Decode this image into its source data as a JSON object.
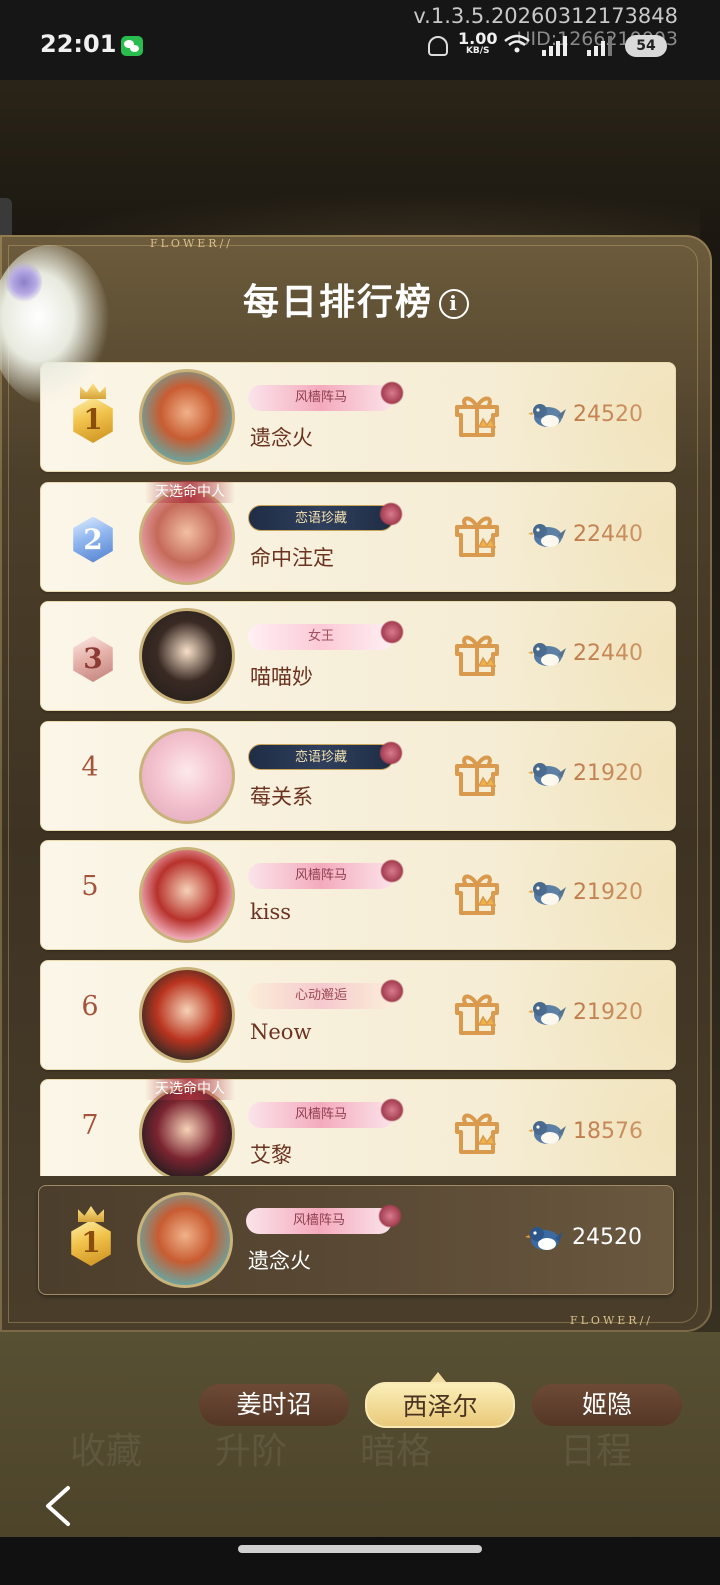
{
  "status_bar": {
    "time": "22:01",
    "version": "v.1.3.5.20260312173848",
    "uid": "UID:1266210003",
    "net_speed": "1.00",
    "net_unit": "KB/S",
    "battery": "54",
    "icons": [
      "wechat-icon",
      "bell-icon",
      "wifi-icon",
      "signal-icon",
      "battery-icon"
    ]
  },
  "panel": {
    "title": "每日排行榜",
    "info_icon": "i",
    "flower_tag": "FLOWER//"
  },
  "ranking": [
    {
      "rank": "1",
      "badge": "gold",
      "name": "遗念火",
      "title_badge": "风樯阵马",
      "title_style": "pink",
      "score": "24520"
    },
    {
      "rank": "2",
      "badge": "blue",
      "name": "命中注定",
      "title_badge": "恋语珍藏",
      "title_style": "dark",
      "avatar_banner": "天选命中人",
      "score": "22440"
    },
    {
      "rank": "3",
      "badge": "rose",
      "name": "喵喵妙",
      "title_badge": "女王",
      "title_style": "light",
      "score": "22440"
    },
    {
      "rank": "4",
      "badge": "",
      "name": "莓关系",
      "title_badge": "恋语珍藏",
      "title_style": "dark",
      "score": "21920"
    },
    {
      "rank": "5",
      "badge": "",
      "name": "kiss",
      "title_badge": "风樯阵马",
      "title_style": "pink",
      "score": "21920"
    },
    {
      "rank": "6",
      "badge": "",
      "name": "Neow",
      "title_badge": "心动邂逅",
      "title_style": "gold",
      "score": "21920"
    },
    {
      "rank": "7",
      "badge": "",
      "name": "艾黎",
      "title_badge": "风樯阵马",
      "title_style": "pink",
      "avatar_banner": "天选命中人",
      "score": "18576"
    }
  ],
  "self_entry": {
    "rank": "1",
    "name": "遗念火",
    "title_badge": "风樯阵马",
    "score": "24520"
  },
  "tabs": [
    {
      "label": "姜时诏",
      "active": false
    },
    {
      "label": "西泽尔",
      "active": true
    },
    {
      "label": "姬隐",
      "active": false
    }
  ],
  "background_text": [
    "收藏",
    "升阶",
    "暗格",
    "日程"
  ],
  "colors": {
    "accent_gold": "#e9c97a",
    "score_brown": "#b25b2c",
    "name_brown": "#6b3320",
    "panel_brown": "#4c3f2a"
  }
}
